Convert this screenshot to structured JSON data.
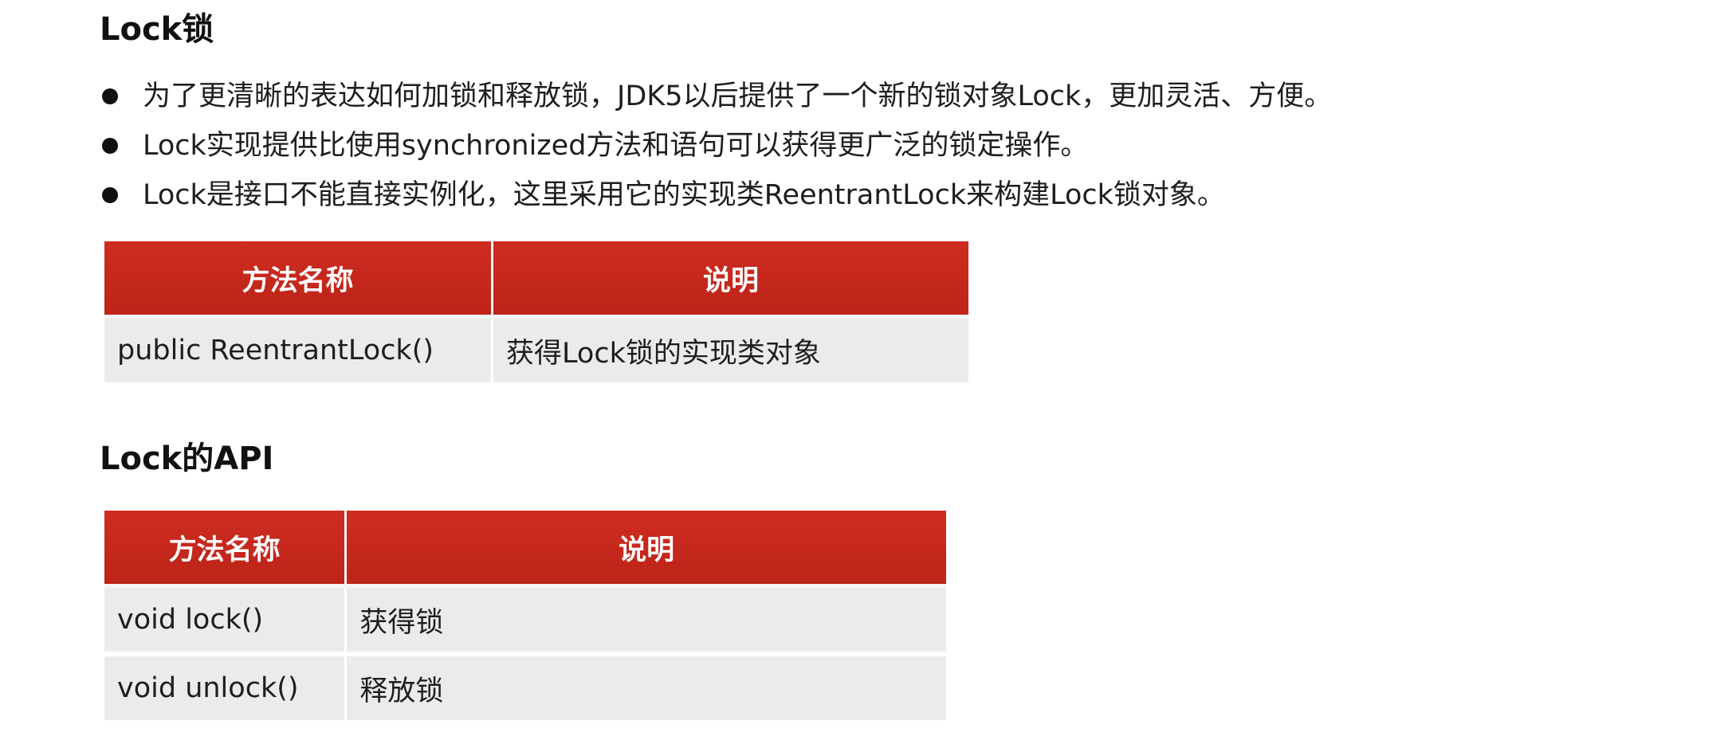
{
  "section1": {
    "title": "Lock锁",
    "bullets": [
      "为了更清晰的表达如何加锁和释放锁，JDK5以后提供了一个新的锁对象Lock，更加灵活、方便。",
      "Lock实现提供比使用synchronized方法和语句可以获得更广泛的锁定操作。",
      "Lock是接口不能直接实例化，这里采用它的实现类ReentrantLock来构建Lock锁对象。"
    ],
    "table": {
      "headers": [
        "方法名称",
        "说明"
      ],
      "rows": [
        [
          "public ReentrantLock()",
          "获得Lock锁的实现类对象"
        ]
      ]
    }
  },
  "section2": {
    "title": "Lock的API",
    "table": {
      "headers": [
        "方法名称",
        "说明"
      ],
      "rows": [
        [
          "void lock()",
          "获得锁"
        ],
        [
          "void unlock()",
          "释放锁"
        ]
      ]
    }
  },
  "colors": {
    "header_bg": "#c8271d",
    "header_text": "#ffffff",
    "row_bg": "#ebebeb",
    "text": "#1e1e1e"
  }
}
